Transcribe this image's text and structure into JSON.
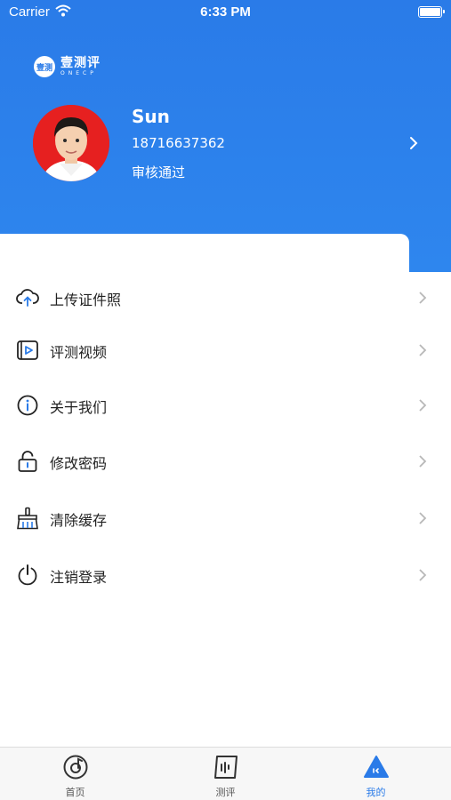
{
  "status_bar": {
    "carrier": "Carrier",
    "time": "6:33 PM"
  },
  "logo": {
    "mark": "壹测",
    "name": "壹测评",
    "subtitle": "ONECP"
  },
  "profile": {
    "name": "Sun",
    "phone": "18716637362",
    "status": "审核通过"
  },
  "menu": [
    {
      "label": "上传证件照",
      "icon": "cloud-upload-icon"
    },
    {
      "label": "评测视频",
      "icon": "video-play-icon"
    },
    {
      "label": "关于我们",
      "icon": "info-icon"
    },
    {
      "label": "修改密码",
      "icon": "lock-icon"
    },
    {
      "label": "清除缓存",
      "icon": "broom-icon"
    },
    {
      "label": "注销登录",
      "icon": "power-icon"
    }
  ],
  "tabs": [
    {
      "label": "首页",
      "icon": "home-disc-icon",
      "active": false
    },
    {
      "label": "测评",
      "icon": "evaluate-icon",
      "active": false
    },
    {
      "label": "我的",
      "icon": "mine-icon",
      "active": true
    }
  ],
  "colors": {
    "primary": "#2a7be8",
    "text": "#222222",
    "avatar_bg": "#e62020"
  }
}
